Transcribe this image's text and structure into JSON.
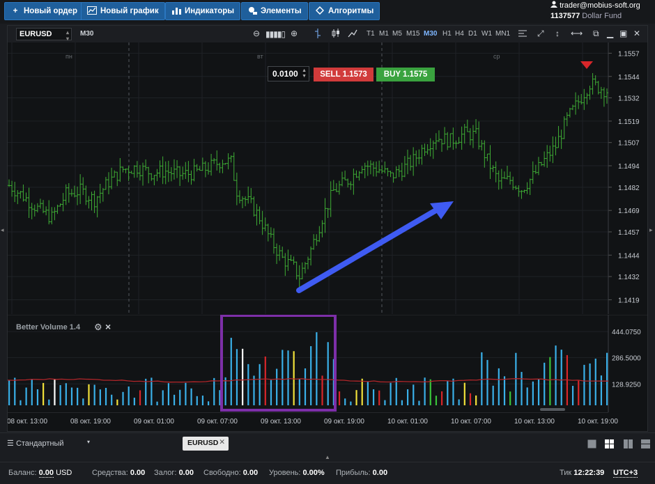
{
  "toolbar": {
    "new_order": "Новый ордер",
    "new_chart": "Новый график",
    "indicators": "Индикаторы",
    "elements": "Элементы",
    "algorithms": "Алгоритмы"
  },
  "account": {
    "email": "trader@mobius-soft.org",
    "number": "1137577",
    "fund": "Dollar Fund"
  },
  "chart": {
    "symbol": "EURUSD",
    "timeframe_label": "M30",
    "timeframes": [
      "T1",
      "M1",
      "M5",
      "M15",
      "M30",
      "H1",
      "H4",
      "D1",
      "W1",
      "MN1"
    ],
    "active_timeframe": "M30",
    "lot": "0.0100",
    "sell_label": "SELL",
    "sell_price": "1.1573",
    "buy_label": "BUY",
    "buy_price": "1.1575",
    "day_labels": [
      "пн",
      "вт",
      "ср"
    ],
    "indicator_title": "Better Volume 1.4"
  },
  "chart_data": {
    "type": "candlestick",
    "price_axis": {
      "ticks": [
        "1.1557",
        "1.1544",
        "1.1532",
        "1.1519",
        "1.1507",
        "1.1494",
        "1.1482",
        "1.1469",
        "1.1457",
        "1.1444",
        "1.1432",
        "1.1419"
      ],
      "range": [
        1.1411,
        1.1563
      ]
    },
    "volume_axis": {
      "ticks": [
        "444.0750",
        "286.5000",
        "128.9250"
      ]
    },
    "x_ticks": [
      "08 окт. 13:00",
      "08 окт. 19:00",
      "09 окт. 01:00",
      "09 окт. 07:00",
      "09 окт. 13:00",
      "09 окт. 19:00",
      "10 окт. 01:00",
      "10 окт. 07:00",
      "10 окт. 13:00",
      "10 окт. 19:00"
    ],
    "price_path": [
      [
        0,
        1.1483
      ],
      [
        5,
        1.1477
      ],
      [
        10,
        1.147
      ],
      [
        15,
        1.1465
      ],
      [
        20,
        1.1478
      ],
      [
        25,
        1.148
      ],
      [
        30,
        1.1475
      ],
      [
        35,
        1.1485
      ],
      [
        40,
        1.1492
      ],
      [
        45,
        1.1493
      ],
      [
        50,
        1.149
      ],
      [
        55,
        1.1491
      ],
      [
        60,
        1.1489
      ],
      [
        65,
        1.149
      ],
      [
        70,
        1.1493
      ],
      [
        75,
        1.1497
      ],
      [
        78,
        1.1496
      ],
      [
        80,
        1.148
      ],
      [
        85,
        1.1472
      ],
      [
        88,
        1.1465
      ],
      [
        92,
        1.1452
      ],
      [
        96,
        1.1442
      ],
      [
        100,
        1.1437
      ],
      [
        102,
        1.1432
      ],
      [
        106,
        1.1447
      ],
      [
        110,
        1.1465
      ],
      [
        114,
        1.148
      ],
      [
        120,
        1.1487
      ],
      [
        124,
        1.1495
      ],
      [
        130,
        1.1492
      ],
      [
        134,
        1.1488
      ],
      [
        138,
        1.1492
      ],
      [
        142,
        1.1497
      ],
      [
        146,
        1.1505
      ],
      [
        150,
        1.151
      ],
      [
        155,
        1.1508
      ],
      [
        160,
        1.1512
      ],
      [
        164,
        1.1511
      ],
      [
        168,
        1.1497
      ],
      [
        172,
        1.1485
      ],
      [
        176,
        1.1486
      ],
      [
        180,
        1.1481
      ],
      [
        184,
        1.1488
      ],
      [
        188,
        1.1497
      ],
      [
        192,
        1.1505
      ],
      [
        196,
        1.152
      ],
      [
        200,
        1.153
      ],
      [
        204,
        1.154
      ],
      [
        207,
        1.1538
      ],
      [
        210,
        1.1536
      ]
    ],
    "volume_average": 150,
    "volume_scale_max": 520
  },
  "annotations": {
    "arrow_color": "#3f5bf2",
    "box_color": "#7d2fa8"
  },
  "tabs": {
    "layout_name": "Стандартный",
    "open_tab": "EURUSD"
  },
  "status": {
    "balance_label": "Баланс:",
    "balance_value": "0.00",
    "balance_currency": "USD",
    "funds_label": "Средства:",
    "funds_value": "0.00",
    "margin_label": "Залог:",
    "margin_value": "0.00",
    "free_label": "Свободно:",
    "free_value": "0.00",
    "level_label": "Уровень:",
    "level_value": "0.00%",
    "profit_label": "Прибыль:",
    "profit_value": "0.00",
    "tick_label": "Тик",
    "time": "12:22:39",
    "timezone": "UTC+3"
  },
  "colors": {
    "candle": "#3fae35",
    "sell": "#d13b3b",
    "buy": "#3aa33f",
    "volume_default": "#3ab0e8",
    "volume_green": "#39c23a",
    "volume_red": "#d8262a",
    "volume_white": "#ffffff",
    "volume_yellow": "#f1e13a",
    "average_line": "#b2262a"
  }
}
